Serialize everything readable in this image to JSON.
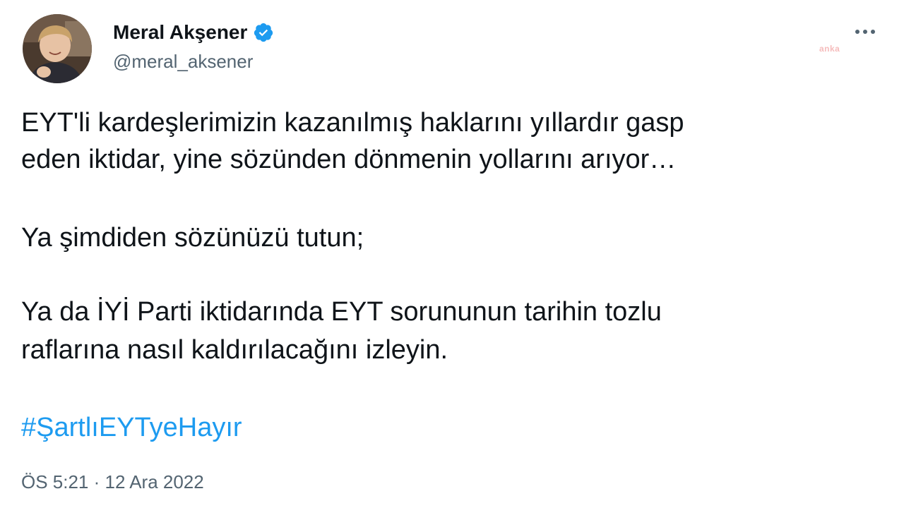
{
  "author": {
    "name": "Meral Akşener",
    "handle": "@meral_aksener",
    "verified": true,
    "verified_icon": "verified-badge-icon",
    "avatar_icon": "profile-photo"
  },
  "menu": {
    "icon": "more-options-icon"
  },
  "watermark": {
    "text": "anka"
  },
  "tweet": {
    "lines": [
      "EYT'li kardeşlerimizin kazanılmış haklarını yıllardır gasp",
      "eden iktidar, yine sözünden dönmenin yollarını arıyor…",
      "Ya şimdiden sözünüzü tutun;",
      "Ya da İYİ Parti iktidarında EYT sorununun tarihin tozlu",
      "raflarına nasıl kaldırılacağını izleyin."
    ],
    "hashtag": "#ŞartlıEYTyeHayır",
    "timestamp": "ÖS 5:21 · 12 Ara 2022"
  },
  "colors": {
    "text": "#0f1419",
    "secondary": "#536471",
    "link": "#1d9bf0",
    "verified": "#1d9bf0"
  }
}
